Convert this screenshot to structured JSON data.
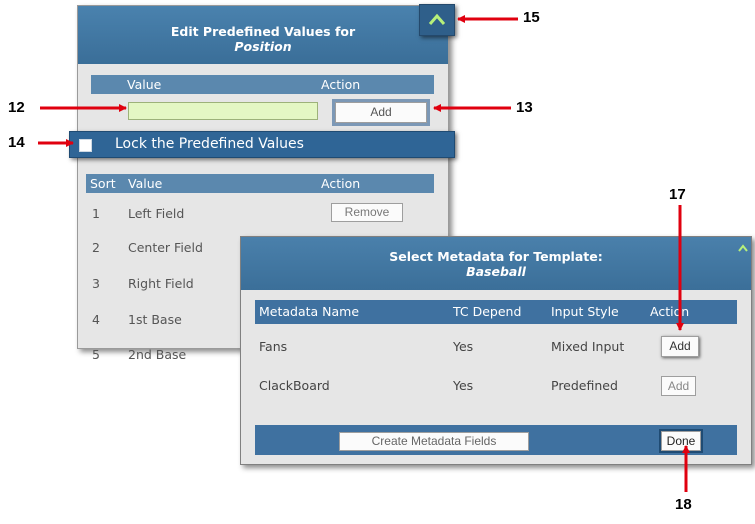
{
  "predefined": {
    "title": "Edit Predefined Values for",
    "subtitle": "Position",
    "col_value": "Value",
    "col_action": "Action",
    "value_input": "",
    "add_label": "Add",
    "lock_label": "Lock the Predefined Values",
    "list_header": {
      "sort": "Sort",
      "value": "Value",
      "action": "Action"
    },
    "rows": [
      {
        "sort": "1",
        "value": "Left Field",
        "action": "Remove"
      },
      {
        "sort": "2",
        "value": "Center Field"
      },
      {
        "sort": "3",
        "value": "Right Field"
      },
      {
        "sort": "4",
        "value": "1st Base"
      },
      {
        "sort": "5",
        "value": "2nd Base"
      }
    ]
  },
  "metadata": {
    "title": "Select Metadata for Template:",
    "subtitle": "Baseball",
    "headers": {
      "name": "Metadata Name",
      "tc": "TC Depend",
      "input": "Input Style",
      "action": "Action"
    },
    "rows": [
      {
        "name": "Fans",
        "tc": "Yes",
        "input": "Mixed Input",
        "action": "Add"
      },
      {
        "name": "ClackBoard",
        "tc": "Yes",
        "input": "Predefined",
        "action": "Add"
      }
    ],
    "create_label": "Create Metadata Fields",
    "done_label": "Done"
  },
  "callouts": {
    "c12": "12",
    "c13": "13",
    "c14": "14",
    "c15": "15",
    "c17": "17",
    "c18": "18"
  },
  "colors": {
    "header_blue": "#3a6e98",
    "arrow_red": "#e0000f",
    "input_green": "#e4f7c4"
  },
  "icons": {
    "collapse": "chevron-up-icon"
  }
}
